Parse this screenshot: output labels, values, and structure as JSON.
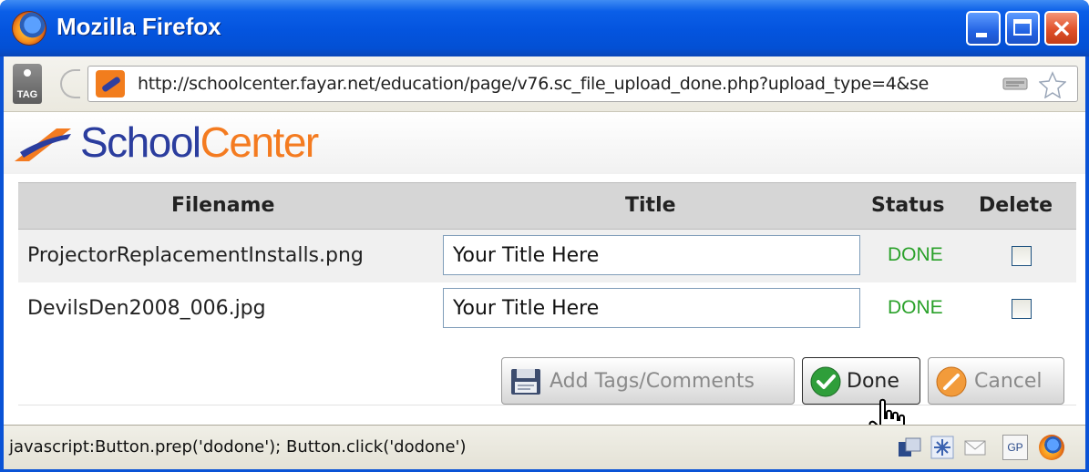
{
  "window": {
    "title": "Mozilla Firefox",
    "controls": {
      "minimize": "minimize",
      "maximize": "maximize",
      "close": "×"
    }
  },
  "toolbar": {
    "tag_label": "TAG",
    "url": "http://schoolcenter.fayar.net/education/page/v76.sc_file_upload_done.php?upload_type=4&se"
  },
  "brand": {
    "school": "School",
    "center": "Center"
  },
  "table": {
    "headers": {
      "filename": "Filename",
      "title": "Title",
      "status": "Status",
      "delete": "Delete"
    },
    "rows": [
      {
        "filename": "ProjectorReplacementInstalls.png",
        "title": "Your Title Here",
        "status": "DONE",
        "delete": false
      },
      {
        "filename": "DevilsDen2008_006.jpg",
        "title": "Your Title Here",
        "status": "DONE",
        "delete": false
      }
    ]
  },
  "buttons": {
    "tags": "Add Tags/Comments",
    "done": "Done",
    "cancel": "Cancel"
  },
  "statusbar": {
    "text": "javascript:Button.prep('dodone'); Button.click('dodone')",
    "gp_label": "GP"
  },
  "colors": {
    "titlebar": "#0454de",
    "status_done": "#2aa12a",
    "brand_blue": "#2b3d9e",
    "brand_orange": "#f47b20"
  },
  "icons": [
    "firefox-icon",
    "tag-icon",
    "site-favicon",
    "feed-icon",
    "star-icon",
    "save-icon",
    "check-icon",
    "cancel-icon",
    "hand-cursor"
  ]
}
